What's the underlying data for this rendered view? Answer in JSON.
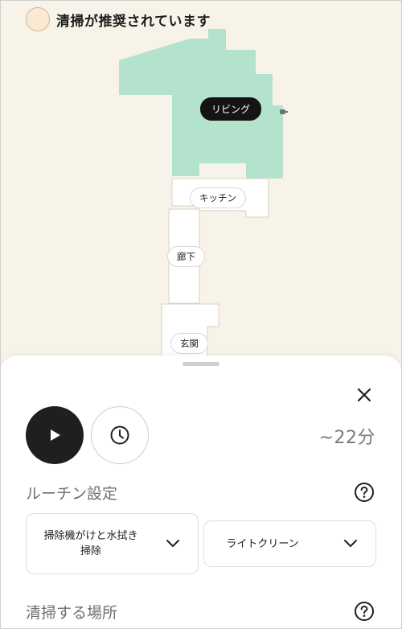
{
  "header": {
    "status_text": "清掃が推奨されています",
    "status_dot_color": "#fde9d2"
  },
  "map": {
    "colors": {
      "background": "#f7f3e9",
      "selected_room": "#b3e3cc",
      "unselected_room": "#ffffff",
      "wall": "#d8d1c3"
    },
    "rooms": [
      {
        "id": "living",
        "label": "リビング",
        "selected": true
      },
      {
        "id": "kitchen",
        "label": "キッチン",
        "selected": false
      },
      {
        "id": "hallway",
        "label": "廊下",
        "selected": false
      },
      {
        "id": "entrance",
        "label": "玄関",
        "selected": false
      }
    ],
    "dock_icon": "dock-icon"
  },
  "sheet": {
    "close_icon": "close-icon",
    "play_icon": "play-icon",
    "schedule_icon": "clock-icon",
    "estimated_time": "~22分",
    "routine": {
      "title": "ルーチン設定",
      "help_icon": "help-icon",
      "mode_value": "掃除機がけと水拭き掃除",
      "mode_line1": "掃除機がけと水拭き",
      "mode_line2": "掃除",
      "intensity_value": "ライトクリーン"
    },
    "location": {
      "title": "清掃する場所",
      "help_icon": "help-icon"
    }
  }
}
